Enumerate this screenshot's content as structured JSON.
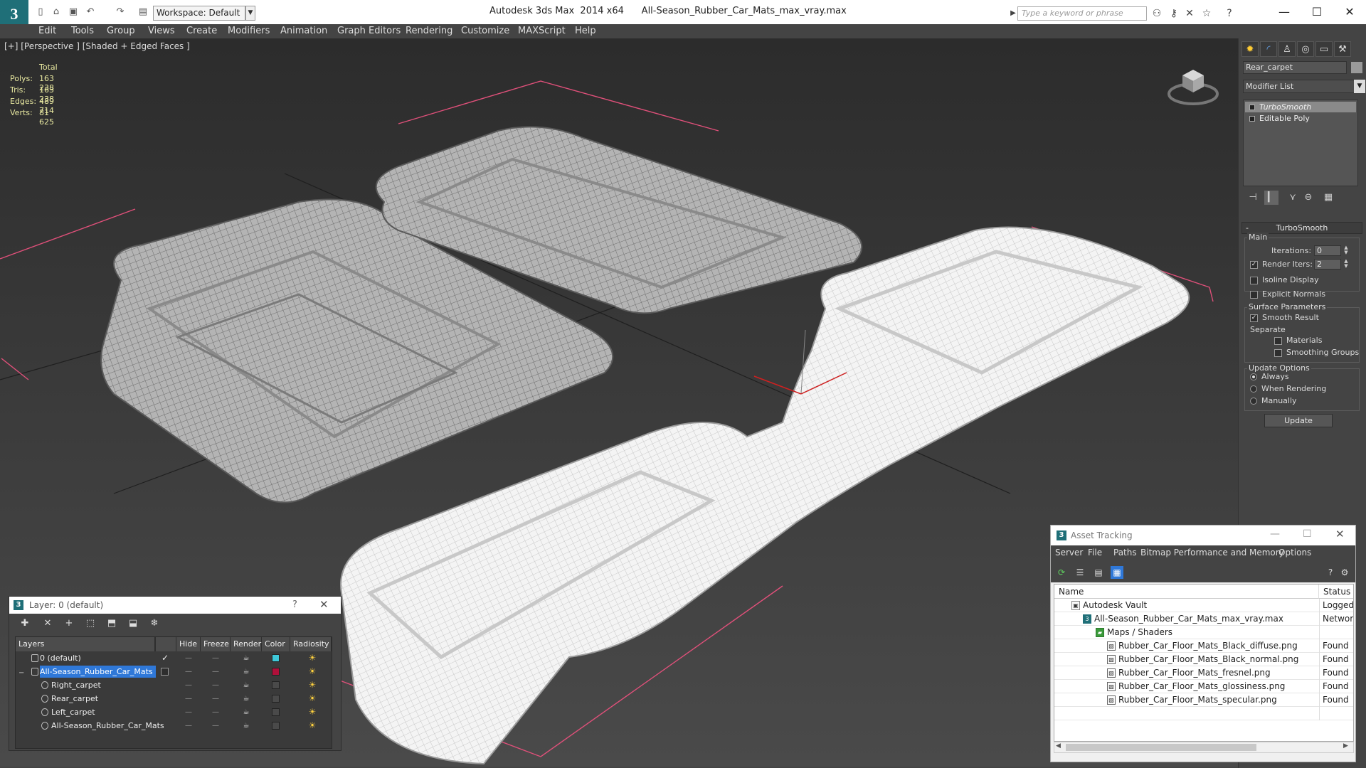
{
  "titlebar": {
    "app_title": "Autodesk 3ds Max  2014 x64      All-Season_Rubber_Car_Mats_max_vray.max",
    "workspace": "Workspace: Default",
    "search_placeholder": "Type a keyword or phrase",
    "logo_text": "3"
  },
  "menu": [
    "Edit",
    "Tools",
    "Group",
    "Views",
    "Create",
    "Modifiers",
    "Animation",
    "Graph Editors",
    "Rendering",
    "Customize",
    "MAXScript",
    "Help"
  ],
  "viewport": {
    "label": "[+] [Perspective ] [Shaded + Edged Faces ]",
    "stats": {
      "header": "Total",
      "rows": [
        {
          "label": "Polys:",
          "value": "163 238"
        },
        {
          "label": "Tris:",
          "value": "163 238"
        },
        {
          "label": "Edges:",
          "value": "489 714"
        },
        {
          "label": "Verts:",
          "value": "81 625"
        }
      ]
    }
  },
  "command_panel": {
    "object_name": "Rear_carpet",
    "modifier_list": "Modifier List",
    "stack": [
      "TurboSmooth",
      "Editable Poly"
    ],
    "rollout_title": "TurboSmooth",
    "rollout_toggle": "-",
    "main_group": "Main",
    "iterations_label": "Iterations:",
    "iterations_value": "0",
    "render_iters_label": "Render Iters:",
    "render_iters_value": "2",
    "isoline_label": "Isoline Display",
    "explicit_normals_label": "Explicit Normals",
    "surface_group": "Surface Parameters",
    "smooth_result_label": "Smooth Result",
    "separate_label": "Separate",
    "materials_label": "Materials",
    "smoothing_groups_label": "Smoothing Groups",
    "update_group": "Update Options",
    "always_label": "Always",
    "when_rendering_label": "When Rendering",
    "manually_label": "Manually",
    "update_button": "Update",
    "render_iters_checked": true,
    "smooth_result_checked": true
  },
  "layer_dialog": {
    "title": "Layer: 0 (default)",
    "help": "?",
    "columns": [
      "Layers",
      "Hide",
      "Freeze",
      "Render",
      "Color",
      "Radiosity"
    ],
    "rows": [
      {
        "name": "0 (default)",
        "color": "#3ec8d8",
        "level": 0,
        "selected": false,
        "active": true
      },
      {
        "name": "All-Season_Rubber_Car_Mats",
        "color": "#b0103a",
        "level": 0,
        "selected": true,
        "active": false
      },
      {
        "name": "Right_carpet",
        "color": "#4a4a4a",
        "level": 1,
        "selected": false,
        "active": false
      },
      {
        "name": "Rear_carpet",
        "color": "#4a4a4a",
        "level": 1,
        "selected": false,
        "active": false
      },
      {
        "name": "Left_carpet",
        "color": "#4a4a4a",
        "level": 1,
        "selected": false,
        "active": false
      },
      {
        "name": "All-Season_Rubber_Car_Mats",
        "color": "#4a4a4a",
        "level": 1,
        "selected": false,
        "active": false
      }
    ]
  },
  "asset_dialog": {
    "title": "Asset Tracking",
    "menu": [
      "Server",
      "File",
      "Paths",
      "Bitmap Performance and Memory",
      "Options"
    ],
    "columns": [
      "Name",
      "Status"
    ],
    "rows": [
      {
        "name": "Autodesk Vault",
        "status": "Logged Out",
        "level": 0,
        "icon": "vault"
      },
      {
        "name": "All-Season_Rubber_Car_Mats_max_vray.max",
        "status": "Network Path",
        "level": 1,
        "icon": "max"
      },
      {
        "name": "Maps / Shaders",
        "status": "",
        "level": 2,
        "icon": "folder"
      },
      {
        "name": "Rubber_Car_Floor_Mats_Black_diffuse.png",
        "status": "Found",
        "level": 3,
        "icon": "image"
      },
      {
        "name": "Rubber_Car_Floor_Mats_Black_normal.png",
        "status": "Found",
        "level": 3,
        "icon": "image"
      },
      {
        "name": "Rubber_Car_Floor_Mats_fresnel.png",
        "status": "Found",
        "level": 3,
        "icon": "image"
      },
      {
        "name": "Rubber_Car_Floor_Mats_glossiness.png",
        "status": "Found",
        "level": 3,
        "icon": "image"
      },
      {
        "name": "Rubber_Car_Floor_Mats_specular.png",
        "status": "Found",
        "level": 3,
        "icon": "image"
      }
    ]
  },
  "colors": {
    "viewport_bg": "#3a3a3a",
    "selection": "#2f78d8",
    "stats_text": "#e8e8a0",
    "brand": "#1f6f78"
  }
}
